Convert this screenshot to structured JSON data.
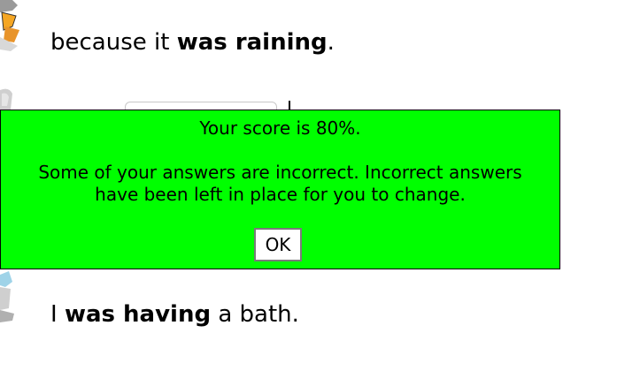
{
  "sentences": {
    "first": {
      "before": "because it ",
      "answer": "was raining",
      "after": "."
    },
    "third": {
      "before": "I ",
      "answer": "was having",
      "after": " a bath."
    }
  },
  "feedback": {
    "score_text": "Your score is 80%.",
    "message": "Some of your answers are incorrect. Incorrect answers have been left in place for you to change.",
    "ok_label": "OK",
    "background_color": "#00ff00"
  },
  "icons": {
    "top": "clipart-figure-icon",
    "middle": "clipart-figure-icon",
    "bottom": "clipart-figure-icon"
  }
}
